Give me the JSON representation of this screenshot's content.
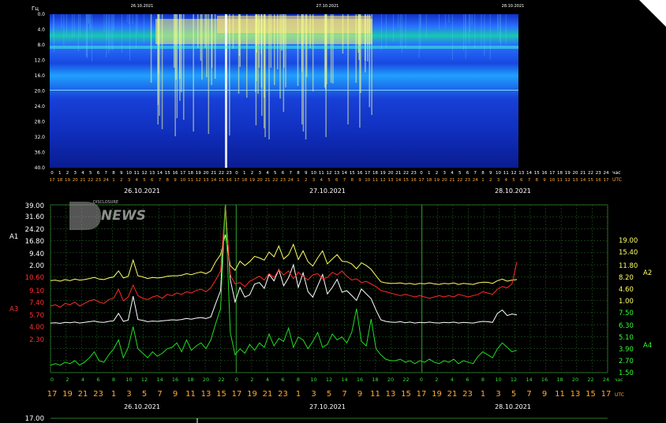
{
  "spectrogram": {
    "y_unit": "Гц",
    "y_ticks": [
      "0.0",
      "4.0",
      "8.0",
      "12.0",
      "16.0",
      "20.0",
      "24.0",
      "28.0",
      "32.0",
      "36.0",
      "40.0"
    ],
    "top_dates": [
      "26.10.2021",
      "27.10.2021",
      "28.10.2021"
    ],
    "hours_top": [
      "0",
      "1",
      "2",
      "3",
      "4",
      "5",
      "6",
      "7",
      "8",
      "9",
      "10",
      "11",
      "12",
      "13",
      "14",
      "15",
      "16",
      "17",
      "18",
      "19",
      "20",
      "21",
      "22",
      "23",
      "0",
      "1",
      "2",
      "3",
      "4",
      "5",
      "6",
      "7",
      "8",
      "9",
      "10",
      "11",
      "12",
      "13",
      "14",
      "15",
      "16",
      "17",
      "18",
      "19",
      "20",
      "21",
      "22",
      "23",
      "0",
      "1",
      "2",
      "3",
      "4",
      "5",
      "6",
      "7",
      "8",
      "9",
      "10",
      "11",
      "12",
      "13",
      "14",
      "15",
      "16",
      "17",
      "18",
      "19",
      "20",
      "21",
      "22",
      "23",
      "24"
    ],
    "hours_bottom": [
      "17",
      "18",
      "19",
      "20",
      "21",
      "22",
      "23",
      "24",
      "1",
      "2",
      "3",
      "4",
      "5",
      "6",
      "7",
      "8",
      "9",
      "10",
      "11",
      "12",
      "13",
      "14",
      "15",
      "16",
      "17",
      "18",
      "19",
      "20",
      "21",
      "22",
      "23",
      "24",
      "1",
      "2",
      "3",
      "4",
      "5",
      "6",
      "7",
      "8",
      "9",
      "10",
      "11",
      "12",
      "13",
      "14",
      "15",
      "16",
      "17",
      "18",
      "19",
      "20",
      "21",
      "22",
      "23",
      "24",
      "1",
      "2",
      "3",
      "4",
      "5",
      "6",
      "7",
      "8",
      "9",
      "10",
      "11",
      "12",
      "13",
      "14",
      "15",
      "16",
      "17"
    ],
    "hour_unit_top": "час",
    "hour_unit_bottom": "UTC",
    "bottom_dates": [
      "26.10.2021",
      "27.10.2021",
      "28.10.2021"
    ]
  },
  "watermark": {
    "word": "NEWS",
    "sub": "DISCLOSURE"
  },
  "chart_data": {
    "type": "line",
    "x": {
      "unit_top": "час",
      "unit_bottom": "UTC",
      "hours_top": [
        "0",
        "2",
        "4",
        "6",
        "8",
        "10",
        "12",
        "14",
        "16",
        "18",
        "20",
        "22",
        "0",
        "2",
        "4",
        "6",
        "8",
        "10",
        "12",
        "14",
        "16",
        "18",
        "20",
        "22",
        "0",
        "2",
        "4",
        "6",
        "8",
        "10",
        "12",
        "14",
        "16",
        "18",
        "20",
        "22",
        "24"
      ],
      "hours_bottom": [
        "17",
        "19",
        "21",
        "23",
        "1",
        "3",
        "5",
        "7",
        "9",
        "11",
        "13",
        "15",
        "17",
        "19",
        "21",
        "23",
        "1",
        "3",
        "5",
        "7",
        "9",
        "11",
        "13",
        "15",
        "17",
        "19",
        "21",
        "23",
        "1",
        "3",
        "5",
        "7",
        "9",
        "11",
        "13",
        "15",
        "17"
      ]
    },
    "dates": [
      "26.10.2021",
      "27.10.2021",
      "28.10.2021"
    ],
    "left_ticks": [
      "39.00",
      "31.60",
      "24.20",
      "16.80",
      "9.40",
      "2.00",
      "10.60",
      "9.10",
      "7.40",
      "5.70",
      "4.00",
      "2.30"
    ],
    "right_ticks": [
      "19.00",
      "15.40",
      "11.80",
      "8.20",
      "4.60",
      "1.00",
      "7.50",
      "6.30",
      "5.10",
      "3.90",
      "2.70",
      "1.50"
    ],
    "left_tick_colors": [
      "#ffffff",
      "#ffffff",
      "#ffffff",
      "#ffffff",
      "#ffffff",
      "#ffffff",
      "#ff3030",
      "#ff3030",
      "#ff3030",
      "#ff3030",
      "#ff3030",
      "#ff3030"
    ],
    "right_tick_colors": [
      "#ffff66",
      "#ffff66",
      "#ffff66",
      "#ffff66",
      "#ffff66",
      "#ffff66",
      "#33ff33",
      "#33ff33",
      "#33ff33",
      "#33ff33",
      "#33ff33",
      "#33ff33"
    ],
    "series": [
      {
        "name": "A1",
        "color": "#ffffff",
        "scale": [
          -12.8,
          39.0
        ],
        "values": [
          2.5,
          2.6,
          2.4,
          2.7,
          2.6,
          2.8,
          2.5,
          2.7,
          2.9,
          3.1,
          2.8,
          2.7,
          3.0,
          3.2,
          5.5,
          3.0,
          3.4,
          10.8,
          3.6,
          3.3,
          2.9,
          3.1,
          3.0,
          3.2,
          3.3,
          3.5,
          3.4,
          3.6,
          3.9,
          3.7,
          4.0,
          4.2,
          3.9,
          4.4,
          8.5,
          12.5,
          39.0,
          16.0,
          9.0,
          13.5,
          10.5,
          11.2,
          14.5,
          15.0,
          13.2,
          17.5,
          15.5,
          19.0,
          14.0,
          16.5,
          20.5,
          13.5,
          18.0,
          12.2,
          10.5,
          14.0,
          17.5,
          11.5,
          13.5,
          16.0,
          12.0,
          12.5,
          11.0,
          9.5,
          13.0,
          11.5,
          10.0,
          6.5,
          3.5,
          3.0,
          2.8,
          2.7,
          2.9,
          2.6,
          2.8,
          2.5,
          2.7,
          2.6,
          2.8,
          2.6,
          2.5,
          2.7,
          2.6,
          2.8,
          2.5,
          2.7,
          2.6,
          2.5,
          2.8,
          3.0,
          2.9,
          2.7,
          5.5,
          6.5,
          4.8,
          5.3,
          5.0
        ]
      },
      {
        "name": "A2",
        "color": "#ffff66",
        "scale": [
          -11.96,
          19.0
        ],
        "values": [
          5.0,
          5.1,
          4.9,
          5.2,
          5.0,
          5.3,
          5.1,
          5.2,
          5.4,
          5.6,
          5.3,
          5.2,
          5.5,
          5.7,
          6.8,
          5.5,
          5.8,
          8.8,
          5.9,
          5.7,
          5.4,
          5.6,
          5.5,
          5.6,
          5.8,
          5.9,
          5.9,
          6.0,
          6.3,
          6.1,
          6.4,
          6.6,
          6.3,
          6.8,
          8.5,
          9.8,
          13.5,
          7.8,
          6.9,
          8.6,
          7.8,
          8.5,
          9.5,
          9.2,
          8.8,
          10.3,
          9.4,
          11.4,
          9.0,
          9.8,
          11.7,
          8.9,
          10.5,
          8.5,
          7.7,
          9.2,
          10.5,
          8.1,
          9.0,
          9.8,
          8.6,
          8.5,
          8.1,
          7.2,
          8.3,
          7.8,
          7.1,
          5.9,
          4.8,
          4.6,
          4.5,
          4.5,
          4.6,
          4.4,
          4.5,
          4.3,
          4.5,
          4.4,
          4.6,
          4.4,
          4.3,
          4.5,
          4.4,
          4.6,
          4.3,
          4.5,
          4.4,
          4.3,
          4.6,
          4.7,
          4.7,
          4.5,
          5.0,
          5.3,
          4.9,
          5.1,
          5.2
        ]
      },
      {
        "name": "A3",
        "color": "#ff2a2a",
        "scale": [
          -2.33,
          10.6
        ],
        "values": [
          2.8,
          2.9,
          2.7,
          3.0,
          2.9,
          3.1,
          2.8,
          3.0,
          3.2,
          3.3,
          3.1,
          3.0,
          3.3,
          3.4,
          4.1,
          3.2,
          3.5,
          4.4,
          3.6,
          3.4,
          3.3,
          3.5,
          3.6,
          3.4,
          3.7,
          3.6,
          3.8,
          3.7,
          3.9,
          3.8,
          4.0,
          4.1,
          3.9,
          4.2,
          4.8,
          5.5,
          10.6,
          5.2,
          4.5,
          4.6,
          4.3,
          4.7,
          4.9,
          5.1,
          4.8,
          5.3,
          5.0,
          5.6,
          5.2,
          5.5,
          4.9,
          5.4,
          5.1,
          4.8,
          5.2,
          5.3,
          4.9,
          5.0,
          5.4,
          5.2,
          5.5,
          5.1,
          4.8,
          4.9,
          4.6,
          4.7,
          4.5,
          4.3,
          4.0,
          3.9,
          3.8,
          3.7,
          3.6,
          3.7,
          3.6,
          3.5,
          3.6,
          3.5,
          3.4,
          3.5,
          3.6,
          3.5,
          3.6,
          3.5,
          3.7,
          3.6,
          3.5,
          3.6,
          3.7,
          3.9,
          3.8,
          3.7,
          4.1,
          4.3,
          4.2,
          4.5,
          6.2
        ]
      },
      {
        "name": "A4",
        "color": "#22dd22",
        "scale": [
          1.2,
          12.5
        ],
        "values": [
          1.7,
          1.8,
          1.7,
          1.9,
          1.8,
          2.0,
          1.7,
          1.9,
          2.2,
          2.6,
          2.0,
          1.9,
          2.4,
          2.8,
          3.4,
          2.2,
          2.9,
          4.3,
          2.8,
          2.5,
          2.2,
          2.6,
          2.3,
          2.5,
          2.8,
          2.9,
          3.2,
          2.6,
          3.4,
          2.7,
          3.0,
          3.2,
          2.8,
          3.4,
          4.5,
          5.5,
          12.5,
          3.9,
          2.4,
          2.8,
          2.5,
          3.1,
          2.7,
          3.2,
          2.9,
          3.8,
          3.0,
          3.5,
          3.3,
          4.2,
          2.9,
          3.6,
          3.4,
          2.8,
          3.3,
          3.9,
          2.9,
          3.1,
          3.8,
          3.4,
          3.6,
          3.2,
          3.9,
          5.5,
          3.3,
          3.0,
          4.8,
          2.8,
          2.4,
          2.1,
          2.0,
          2.0,
          2.1,
          1.9,
          2.0,
          1.8,
          2.0,
          1.9,
          2.1,
          1.9,
          1.8,
          2.0,
          1.9,
          2.1,
          1.8,
          2.0,
          1.9,
          1.8,
          2.3,
          2.6,
          2.4,
          2.2,
          2.8,
          3.2,
          2.9,
          2.6,
          2.7
        ]
      }
    ],
    "bottom_panel_top_tick": "17.00"
  }
}
